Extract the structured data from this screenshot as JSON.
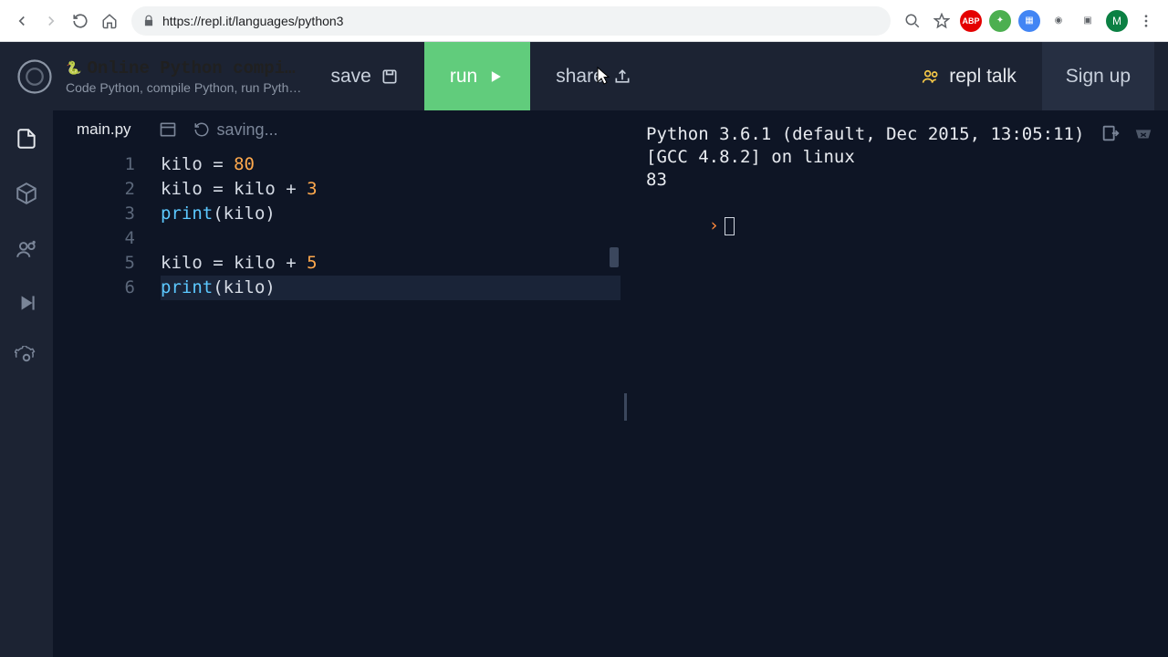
{
  "browser": {
    "url": "https://repl.it/languages/python3",
    "ext_abp": "ABP",
    "avatar_initial": "M"
  },
  "header": {
    "title": "Online Python compiler, O…",
    "subtitle": "Code Python, compile Python, run Python, …",
    "save": "save",
    "run": "run",
    "share": "share",
    "repltalk": "repl talk",
    "signup": "Sign up"
  },
  "editor": {
    "filename": "main.py",
    "saving": "saving...",
    "lines": [
      {
        "n": "1",
        "pre": "kilo = ",
        "num": "80",
        "post": ""
      },
      {
        "n": "2",
        "pre": "kilo = kilo + ",
        "num": "3",
        "post": ""
      },
      {
        "n": "3",
        "fn": "print",
        "post": "(kilo)"
      },
      {
        "n": "4",
        "pre": ""
      },
      {
        "n": "5",
        "pre": "kilo = kilo + ",
        "num": "5",
        "post": ""
      },
      {
        "n": "6",
        "fn": "print",
        "post": "(kilo)"
      }
    ]
  },
  "console": {
    "line1": "Python 3.6.1 (default, Dec 2015, 13:05:11)",
    "line2": "[GCC 4.8.2] on linux",
    "output": "83",
    "prompt": "›"
  }
}
